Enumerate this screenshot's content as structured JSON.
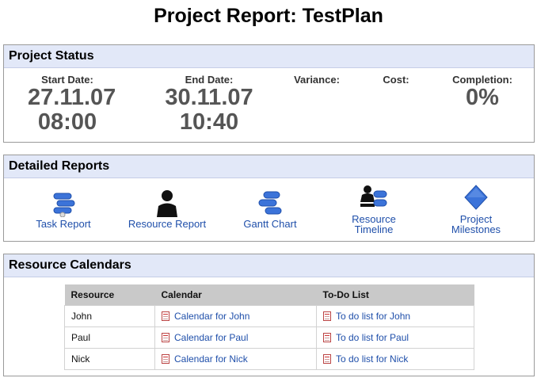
{
  "page": {
    "title": "Project Report: TestPlan"
  },
  "status": {
    "heading": "Project Status",
    "start": {
      "label": "Start Date:",
      "date": "27.11.07",
      "time": "08:00"
    },
    "end": {
      "label": "End Date:",
      "date": "30.11.07",
      "time": "10:40"
    },
    "variance": {
      "label": "Variance:"
    },
    "cost": {
      "label": "Cost:"
    },
    "completion": {
      "label": "Completion:",
      "value": "0%"
    }
  },
  "reports": {
    "heading": "Detailed Reports",
    "items": [
      {
        "label": "Task Report",
        "icon": "task-report-icon"
      },
      {
        "label": "Resource Report",
        "icon": "resource-report-icon"
      },
      {
        "label": "Gantt Chart",
        "icon": "gantt-chart-icon"
      },
      {
        "label_line1": "Resource",
        "label_line2": "Timeline",
        "icon": "resource-timeline-icon"
      },
      {
        "label_line1": "Project",
        "label_line2": "Milestones",
        "icon": "project-milestones-icon"
      }
    ]
  },
  "calendars": {
    "heading": "Resource Calendars",
    "columns": [
      "Resource",
      "Calendar",
      "To-Do List"
    ],
    "rows": [
      {
        "resource": "John",
        "calendar": "Calendar for John",
        "todo": "To do list for John"
      },
      {
        "resource": "Paul",
        "calendar": "Calendar for Paul",
        "todo": "To do list for Paul"
      },
      {
        "resource": "Nick",
        "calendar": "Calendar for Nick",
        "todo": "To do list for Nick"
      }
    ]
  },
  "colors": {
    "header_bg": "#e2e8f8",
    "link": "#1f4faa",
    "icon_blue": "#3b73d9"
  }
}
